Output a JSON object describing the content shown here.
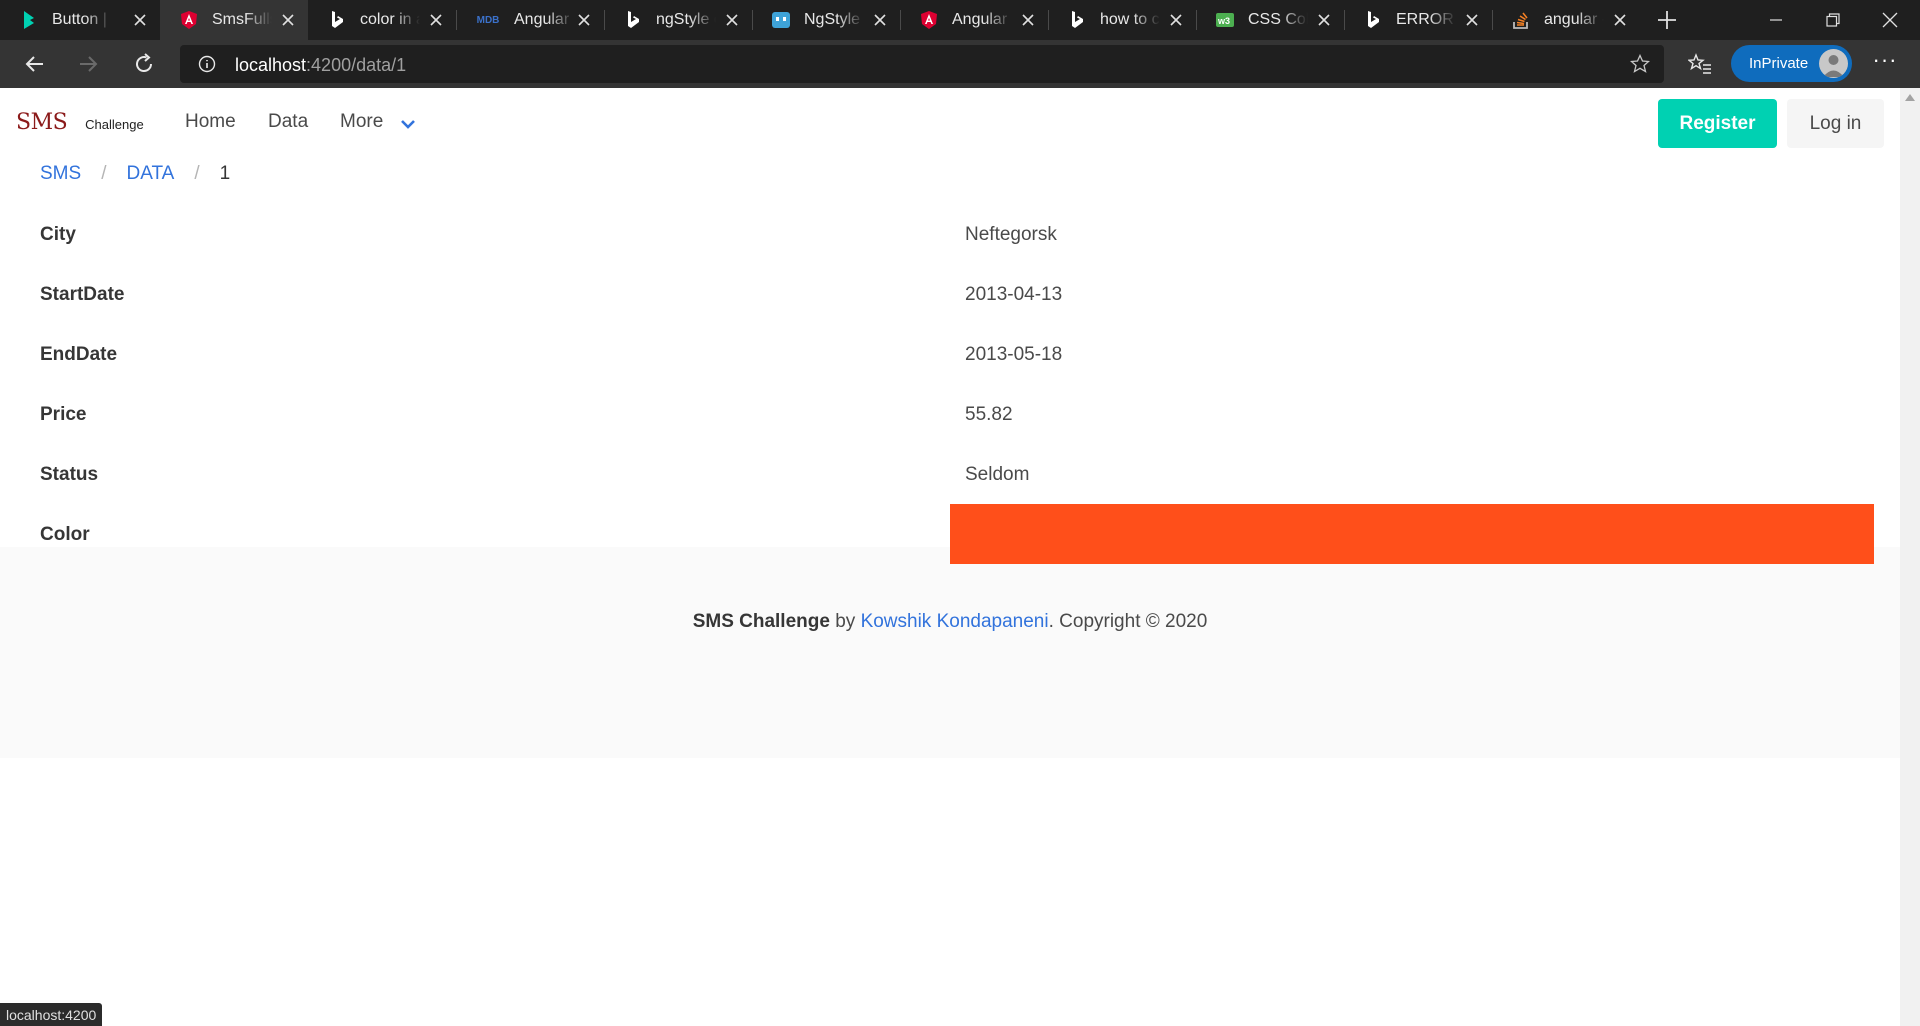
{
  "browser": {
    "tabs": [
      {
        "title": "Button | Bulma",
        "icon": "bulma-icon",
        "icon_color": "#00d1b2"
      },
      {
        "title": "SmsFullstack",
        "icon": "angular-icon",
        "icon_color": "#dd0031",
        "active": true
      },
      {
        "title": "color in angular",
        "icon": "bing-icon",
        "icon_color": "#ffffff"
      },
      {
        "title": "Angular tutorial",
        "icon": "mdb-icon",
        "icon_color": "#3b71ca"
      },
      {
        "title": "ngStyle color",
        "icon": "bing-icon",
        "icon_color": "#ffffff"
      },
      {
        "title": "NgStyle & NgClass",
        "icon": "codecraft-icon",
        "icon_color": "#3ea3d8"
      },
      {
        "title": "Angular - NgStyle",
        "icon": "angular-icon",
        "icon_color": "#dd0031"
      },
      {
        "title": "how to create",
        "icon": "bing-icon",
        "icon_color": "#ffffff"
      },
      {
        "title": "CSS Colors",
        "icon": "w3schools-icon",
        "icon_color": "#4caf50"
      },
      {
        "title": "ERROR Error",
        "icon": "bing-icon",
        "icon_color": "#ffffff"
      },
      {
        "title": "angular - stack",
        "icon": "stackoverflow-icon",
        "icon_color": "#f48024"
      }
    ],
    "address": {
      "host": "localhost",
      "path": ":4200/data/1"
    },
    "inprivate_label": "InPrivate",
    "status_url": "localhost:4200"
  },
  "navbar": {
    "brand_main": "SMS",
    "brand_sub": "Challenge",
    "links": {
      "home": "Home",
      "data": "Data",
      "more": "More"
    },
    "register_label": "Register",
    "login_label": "Log in"
  },
  "breadcrumb": {
    "items": [
      "SMS",
      "DATA"
    ],
    "separator": "/",
    "current": "1"
  },
  "details": {
    "city": {
      "label": "City",
      "value": "Neftegorsk"
    },
    "start_date": {
      "label": "StartDate",
      "value": "2013-04-13"
    },
    "end_date": {
      "label": "EndDate",
      "value": "2013-05-18"
    },
    "price": {
      "label": "Price",
      "value": "55.82"
    },
    "status": {
      "label": "Status",
      "value": "Seldom"
    },
    "color": {
      "label": "Color",
      "value_color": "#ff4f1a"
    }
  },
  "footer": {
    "project": "SMS Challenge",
    "by": " by ",
    "author": "Kowshik Kondapaneni",
    "copyright": ". Copyright © 2020"
  },
  "colors": {
    "accent": "#00d1b2",
    "link": "#3273dc",
    "brand": "#8b1a1a"
  }
}
